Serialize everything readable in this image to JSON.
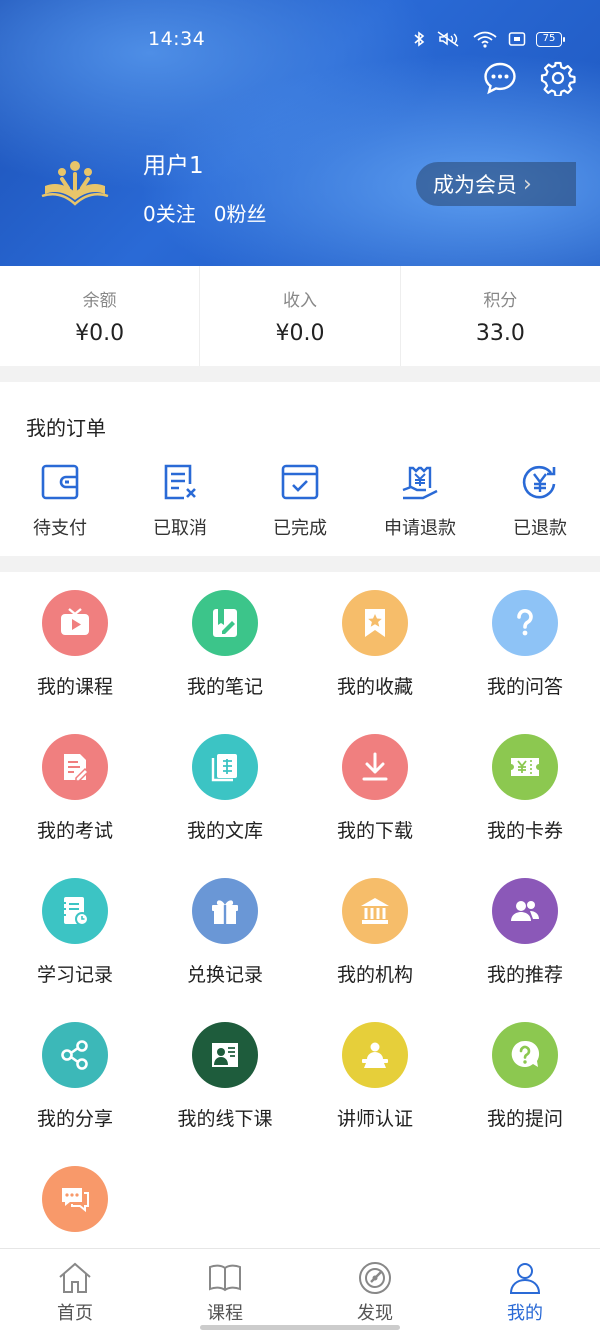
{
  "status_bar": {
    "time": "14:34",
    "battery": "75"
  },
  "profile": {
    "username": "用户1",
    "following": "0关注",
    "followers": "0粉丝",
    "vip_label": "成为会员",
    "vip_chevron": "›"
  },
  "stats": [
    {
      "label": "余额",
      "value": "¥0.0"
    },
    {
      "label": "收入",
      "value": "¥0.0"
    },
    {
      "label": "积分",
      "value": "33.0"
    }
  ],
  "orders": {
    "title": "我的订单",
    "items": [
      {
        "label": "待支付",
        "icon": "wallet-icon"
      },
      {
        "label": "已取消",
        "icon": "cancelled-doc-icon"
      },
      {
        "label": "已完成",
        "icon": "completed-check-icon"
      },
      {
        "label": "申请退款",
        "icon": "refund-request-icon"
      },
      {
        "label": "已退款",
        "icon": "refunded-yen-icon"
      }
    ]
  },
  "grid": [
    {
      "label": "我的课程",
      "icon": "tv-play-icon",
      "color": "#f07f7f"
    },
    {
      "label": "我的笔记",
      "icon": "notebook-pen-icon",
      "color": "#3cc58a"
    },
    {
      "label": "我的收藏",
      "icon": "bookmark-star-icon",
      "color": "#f6bd6a"
    },
    {
      "label": "我的问答",
      "icon": "question-icon",
      "color": "#8ec3f6"
    },
    {
      "label": "我的考试",
      "icon": "exam-paper-icon",
      "color": "#f07f7f"
    },
    {
      "label": "我的文库",
      "icon": "library-book-icon",
      "color": "#3cc4c4"
    },
    {
      "label": "我的下载",
      "icon": "download-icon",
      "color": "#f07f7f"
    },
    {
      "label": "我的卡券",
      "icon": "coupon-icon",
      "color": "#8cc850"
    },
    {
      "label": "学习记录",
      "icon": "study-record-icon",
      "color": "#3cc4c4"
    },
    {
      "label": "兑换记录",
      "icon": "gift-icon",
      "color": "#6a97d6"
    },
    {
      "label": "我的机构",
      "icon": "institution-icon",
      "color": "#f6bd6a"
    },
    {
      "label": "我的推荐",
      "icon": "users-icon",
      "color": "#8b58b8"
    },
    {
      "label": "我的分享",
      "icon": "share-icon",
      "color": "#3cb8b8"
    },
    {
      "label": "我的线下课",
      "icon": "offline-class-icon",
      "color": "#1e5c3c"
    },
    {
      "label": "讲师认证",
      "icon": "lecturer-icon",
      "color": "#e6cf3a"
    },
    {
      "label": "我的提问",
      "icon": "ask-question-icon",
      "color": "#8cc850"
    },
    {
      "label": "",
      "icon": "messages-icon",
      "color": "#f8996a"
    }
  ],
  "tabs": [
    {
      "label": "首页",
      "icon": "home-icon",
      "active": false
    },
    {
      "label": "课程",
      "icon": "book-icon",
      "active": false
    },
    {
      "label": "发现",
      "icon": "discover-icon",
      "active": false
    },
    {
      "label": "我的",
      "icon": "profile-icon",
      "active": true
    }
  ],
  "colors": {
    "brand_blue": "#2a6ad6",
    "gold": "#e8c56a"
  }
}
